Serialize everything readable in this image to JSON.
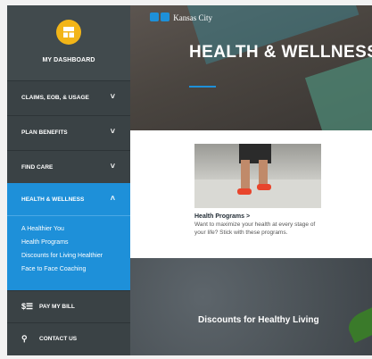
{
  "sidebar": {
    "dashboard_label": "MY DASHBOARD",
    "items": [
      {
        "label": "CLAIMS, EOB, & USAGE",
        "chevron": "˅"
      },
      {
        "label": "PLAN BENEFITS",
        "chevron": "˅"
      },
      {
        "label": "FIND CARE",
        "chevron": "˅"
      },
      {
        "label": "HEALTH & WELLNESS",
        "chevron": "˄"
      }
    ],
    "submenu": [
      "A Healthier You",
      "Health Programs",
      "Discounts for Living Healthier",
      "Face to Face Coaching"
    ],
    "pay_bill": {
      "icon": "$☰",
      "label": "PAY MY BILL"
    },
    "contact": {
      "icon": "⚲",
      "label": "CONTACT US"
    }
  },
  "hero": {
    "logo_text": "Kansas City",
    "title": "HEALTH & WELLNESS"
  },
  "program": {
    "link": "Health Programs >",
    "description": "Want to maximize your health at every stage of your life? Stick with these programs."
  },
  "discounts": {
    "title": "Discounts for Healthy Living"
  },
  "colors": {
    "sidebar": "#3a4245",
    "active": "#1e90d9",
    "accent": "#f2b518"
  }
}
